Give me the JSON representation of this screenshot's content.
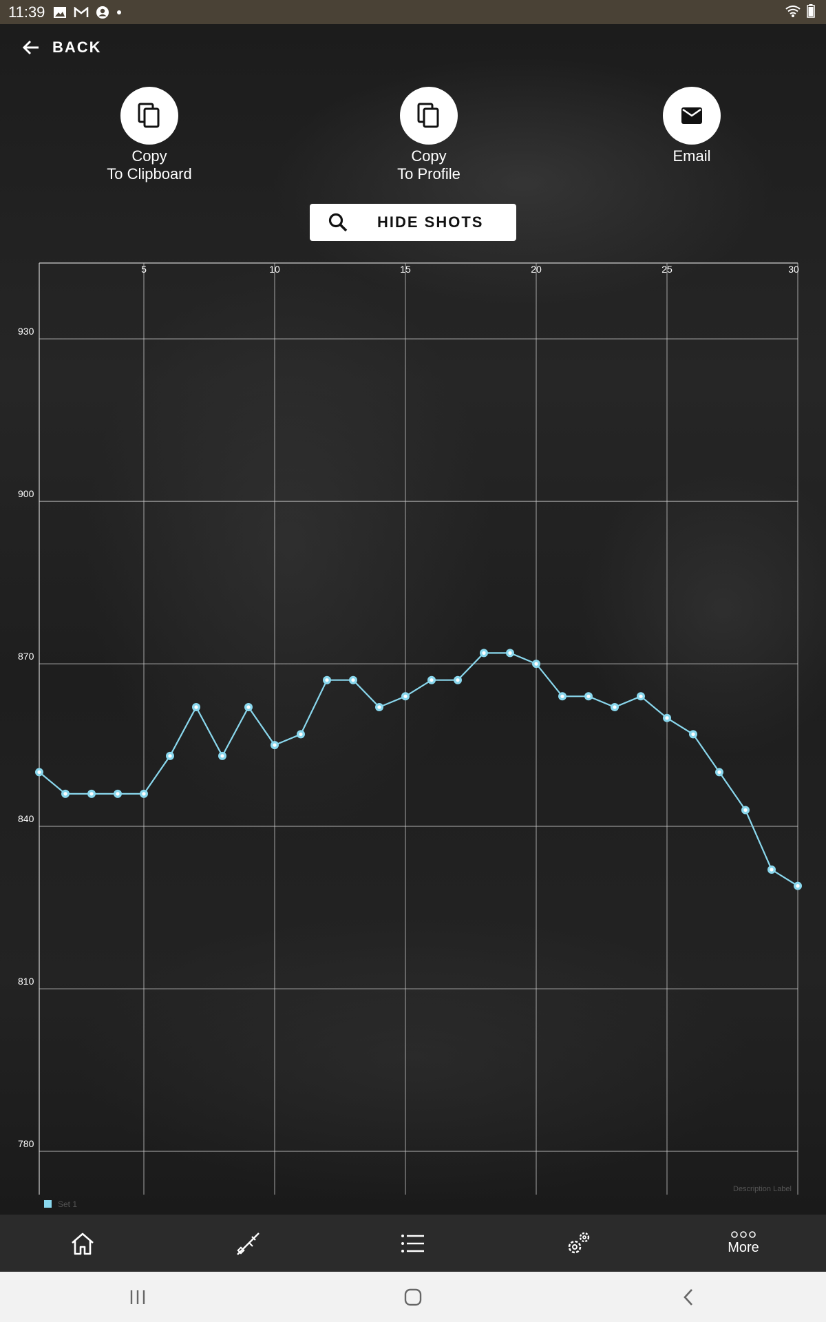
{
  "status_bar": {
    "time": "11:39"
  },
  "header": {
    "back_label": "BACK"
  },
  "actions": [
    {
      "line1": "Copy",
      "line2": "To Clipboard",
      "icon": "copy-icon"
    },
    {
      "line1": "Copy",
      "line2": "To Profile",
      "icon": "copy-icon"
    },
    {
      "line1": "Email",
      "line2": "",
      "icon": "email-icon"
    }
  ],
  "hide_shots_label": "HIDE SHOTS",
  "colors": {
    "line": "#8ad8ee",
    "grid": "#d0d0d0"
  },
  "chart_data": {
    "type": "line",
    "x_ticks": [
      5,
      10,
      15,
      20,
      25,
      30
    ],
    "y_ticks": [
      780,
      810,
      840,
      870,
      900,
      930
    ],
    "xlim": [
      1,
      30
    ],
    "ylim": [
      772,
      944
    ],
    "x": [
      1,
      2,
      3,
      4,
      5,
      6,
      7,
      8,
      9,
      10,
      11,
      12,
      13,
      14,
      15,
      16,
      17,
      18,
      19,
      20,
      21,
      22,
      23,
      24,
      25,
      26,
      27,
      28,
      29,
      30
    ],
    "series": [
      {
        "name": "Set 1",
        "values": [
          850,
          846,
          846,
          846,
          846,
          853,
          862,
          853,
          862,
          855,
          857,
          867,
          867,
          862,
          864,
          867,
          867,
          872,
          872,
          870,
          864,
          864,
          862,
          864,
          860,
          857,
          850,
          843,
          832,
          829
        ]
      }
    ],
    "legend": "bottom-left",
    "grid": true,
    "description_label": "Description Label"
  },
  "bottom_nav": {
    "items": [
      {
        "icon": "home-icon"
      },
      {
        "icon": "rifle-icon"
      },
      {
        "icon": "list-icon"
      },
      {
        "icon": "settings-gears-icon"
      },
      {
        "icon": "more-dots-icon",
        "label": "More"
      }
    ]
  }
}
